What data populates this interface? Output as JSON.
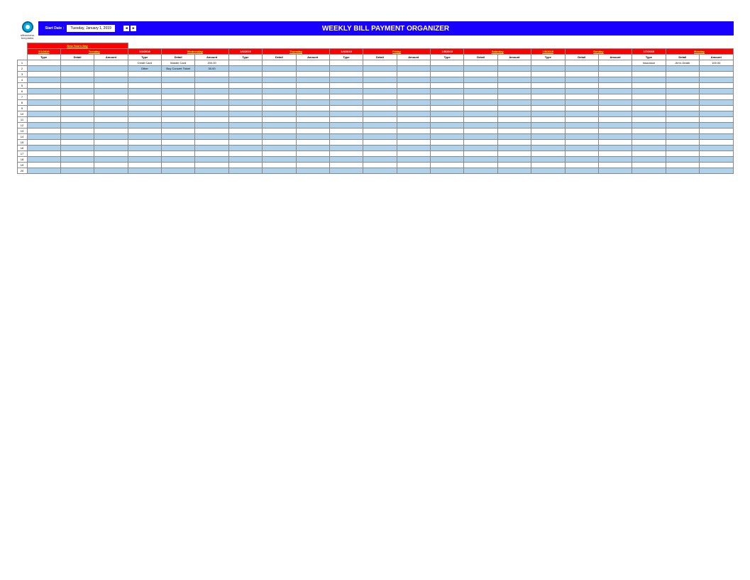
{
  "header": {
    "title": "WEEKLY BILL PAYMENT ORGANIZER",
    "start_date_label": "Start Date :",
    "start_date_value": "Tuesday, January 1, 2019",
    "prev_symbol": "◄",
    "next_symbol": "►",
    "logo_text": "allbusiness templates"
  },
  "holiday": "New Year's Day",
  "days": [
    {
      "date": "1/1/2019",
      "name": "Tuesday",
      "today": true
    },
    {
      "date": "1/2/2019",
      "name": "Wednesday",
      "today": false
    },
    {
      "date": "1/3/2019",
      "name": "Thursday",
      "today": false
    },
    {
      "date": "1/4/2019",
      "name": "Friday",
      "today": false
    },
    {
      "date": "1/5/2019",
      "name": "Saturday",
      "today": false
    },
    {
      "date": "1/6/2019",
      "name": "Sunday",
      "today": true
    },
    {
      "date": "1/7/2019",
      "name": "Monday",
      "today": false
    }
  ],
  "columns": [
    "Type",
    "Detail",
    "Amount"
  ],
  "row_numbers": [
    "1",
    "2",
    "3",
    "4",
    "5",
    "6",
    "7",
    "8",
    "9",
    "10",
    "11",
    "12",
    "13",
    "14",
    "15",
    "16",
    "17",
    "18",
    "19",
    "20"
  ],
  "entries": {
    "day1_row0": [
      "Credit Card",
      "Master Card",
      "200.00"
    ],
    "day1_row1": [
      "Other",
      "Buy Concert Ticket",
      "30.00"
    ],
    "day6_row0": [
      "Insurance",
      "Jim's Death",
      "100.00"
    ]
  }
}
